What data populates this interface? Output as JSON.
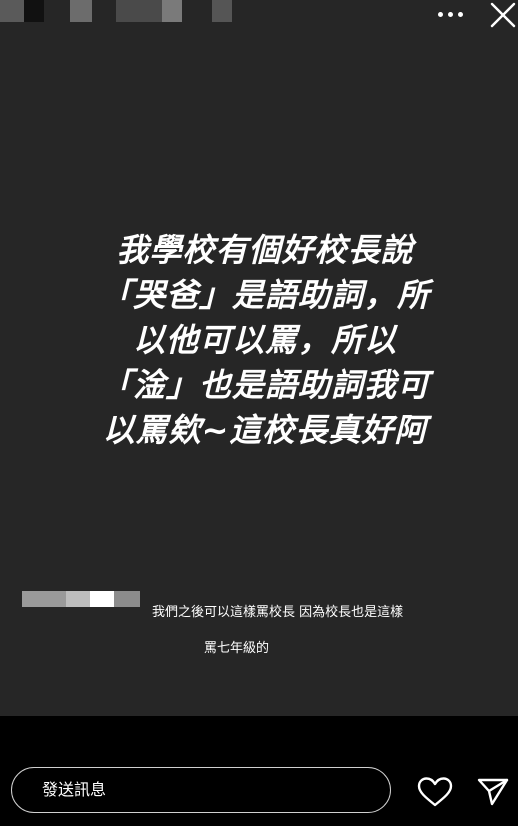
{
  "story": {
    "headline": "我學校有個好校長說\n「哭爸」是語助詞，所\n以他可以罵，所以\n「淦」也是語助詞我可\n以罵欸~這校長真好阿",
    "reply": {
      "text_line1": "我們之後可以這樣罵校長 因為校長也是這樣",
      "text_line2": "罵七年級的"
    }
  },
  "composer": {
    "placeholder": "發送訊息"
  },
  "icons": {
    "more": "more-dots-icon",
    "close": "close-icon",
    "like": "heart-icon",
    "send": "send-icon"
  },
  "colors": {
    "story_background": "#262626",
    "page_background": "#000000",
    "text": "#ffffff"
  }
}
